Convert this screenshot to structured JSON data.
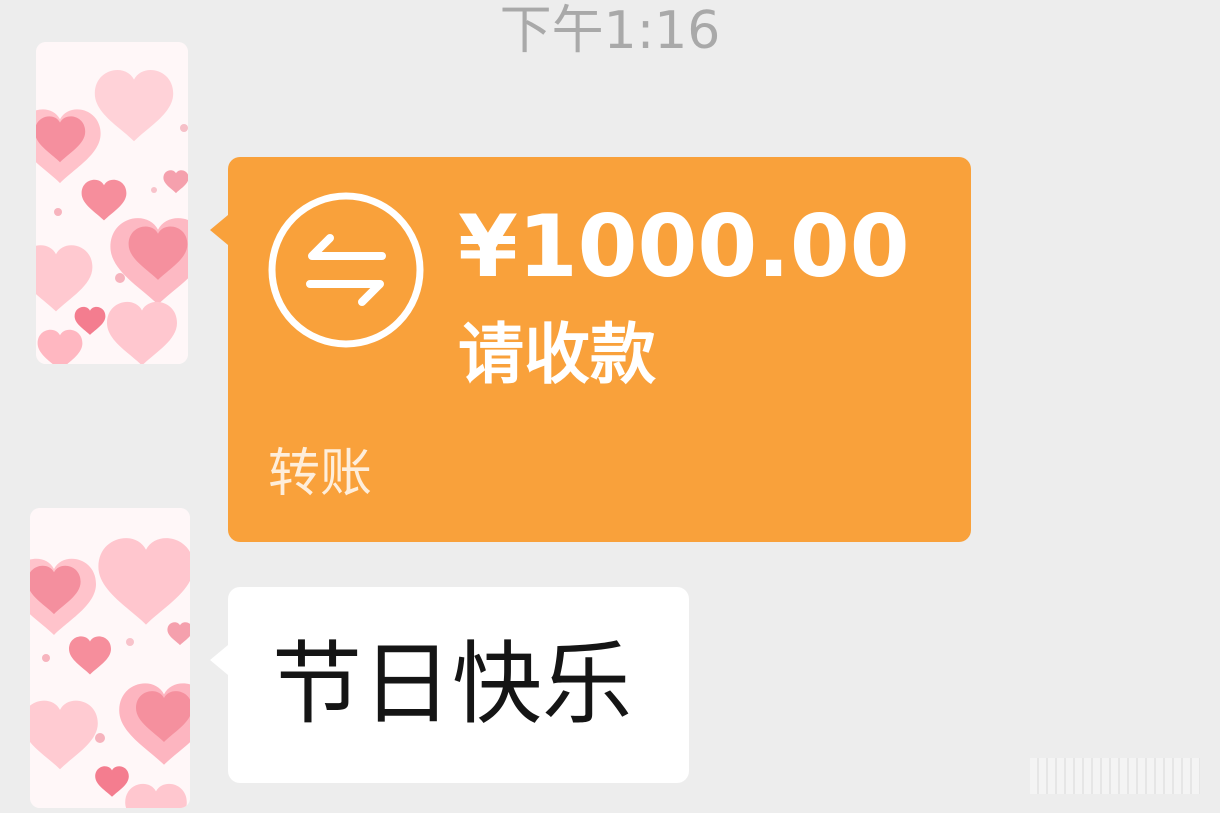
{
  "chat": {
    "timestamp": "下午1:16",
    "transfer": {
      "amount": "¥1000.00",
      "status": "请收款",
      "label": "转账",
      "icon": "transfer-arrows-icon",
      "color": "#f9a13b"
    },
    "message": {
      "text": "节日快乐"
    }
  },
  "avatar": {
    "icon": "heart-pattern-avatar",
    "colors": [
      "#fba8b1",
      "#ffd0d6"
    ]
  }
}
